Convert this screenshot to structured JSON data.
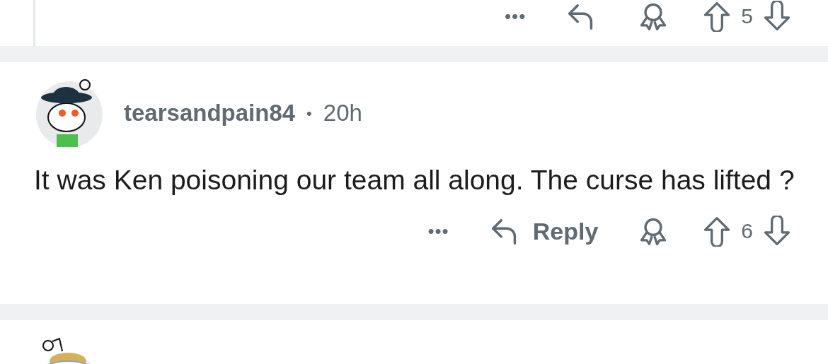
{
  "previous_comment": {
    "actions": {
      "more": "•••",
      "score": "5"
    }
  },
  "comment": {
    "username": "tearsandpain84",
    "separator": "•",
    "time": "20h",
    "body": "It was Ken poisoning our team all along. The curse has lifted ?",
    "actions": {
      "more": "•••",
      "reply": "Reply",
      "score": "6"
    }
  }
}
